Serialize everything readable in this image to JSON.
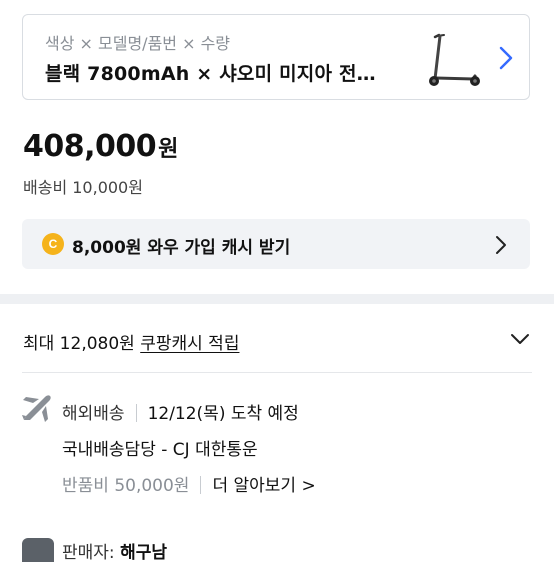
{
  "option_card": {
    "meta": "색상 × 모델명/품번 × 수량",
    "value": "블랙 7800mAh × 샤오미 미지아 전…",
    "thumbnail_icon": "scooter-thumbnail",
    "chevron_icon": "chevron-right-icon"
  },
  "price": {
    "amount": "408,000",
    "unit": "원",
    "shipping": "배송비 10,000원"
  },
  "cash_banner": {
    "coin_label": "C",
    "text": "8,000원 와우 가입 캐시 받기",
    "coin_color": "#f5b31b"
  },
  "reward": {
    "prefix": "최대 12,080원",
    "link": "쿠팡캐시 적립"
  },
  "delivery": {
    "type": "해외배송",
    "eta": "12/12(목) 도착 예정",
    "carrier": "국내배송담당 - CJ 대한통운",
    "return_fee": "반품비 50,000원",
    "learn_more": "더 알아보기 >"
  },
  "seller": {
    "label": "판매자:",
    "name": "해구남"
  },
  "colors": {
    "accent_blue": "#346aff",
    "banner_bg": "#f1f3f6",
    "text_muted": "#8a8f96"
  }
}
